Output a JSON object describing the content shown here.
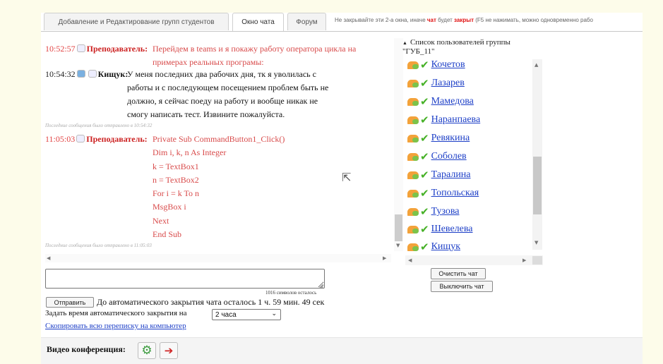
{
  "tabs": [
    {
      "label": "Добавление и Редактирование групп студентов",
      "active": false
    },
    {
      "label": "Окно чата",
      "active": true
    },
    {
      "label": "Форум",
      "active": false
    }
  ],
  "notice": {
    "before": "Не закрывайте эти 2-а окна, иначе ",
    "red": "чат",
    "middle": " будет ",
    "red2": "закрыт",
    "after": " (F5 не нажимать, можно одновременно рабо"
  },
  "chat": {
    "messages": [
      {
        "time": "10:52:57",
        "sender": "Преподаватель:",
        "lines": [
          "Перейдем в teams и я покажу работу оператора цикла на",
          "примерах реальных програмы:"
        ]
      },
      {
        "time": "10:54:32",
        "sender": "Кищук:",
        "lines": [
          "У меня последних два рабочих дня, тк я уволилась с",
          "работы и с последующем посещением проблем быть не",
          "должно, я сейчас поеду на работу и вообще никак не",
          "смогу написать тест. Извините пожалуйста."
        ],
        "note": "Последние сообщения было отправлено в 10:54:32"
      },
      {
        "time": "11:05:03",
        "sender": "Преподаватель:",
        "lines": [
          "Private Sub CommandButton1_Click()",
          "Dim i, k, n As Integer",
          "k = TextBox1",
          "n = TextBox2",
          "For i = k To n",
          "MsgBox i",
          "Next",
          "End Sub"
        ],
        "note": "Последние сообщения было отправлено в 11:05:03"
      }
    ]
  },
  "users": {
    "title": "Список пользователей группы \"ГУБ_11\"",
    "names": [
      "Кочетов",
      "Лазарев",
      "Мамедова",
      "Наранпаева",
      "Ревякина",
      "Соболев",
      "Таралина",
      "Топольская",
      "Тузова",
      "Шевелева",
      "Кищук"
    ]
  },
  "buttons": {
    "clear": "Очистить чат",
    "disable": "Выключить чат",
    "send": "Отправить"
  },
  "input": {
    "value": "",
    "char_count": "1016 символов осталось"
  },
  "auto_close": {
    "status": "До автоматического закрытия чата осталось 1 ч. 59 мин. 49 сек",
    "set_label": "Задать время автоматического закрытия на",
    "selected": "2 часа"
  },
  "copy_link": "Скопировать всю переписку на компьютер",
  "video": {
    "label": "Видео конференция:",
    "start_icon": "gear-icon",
    "exit_icon": "exit-icon"
  }
}
